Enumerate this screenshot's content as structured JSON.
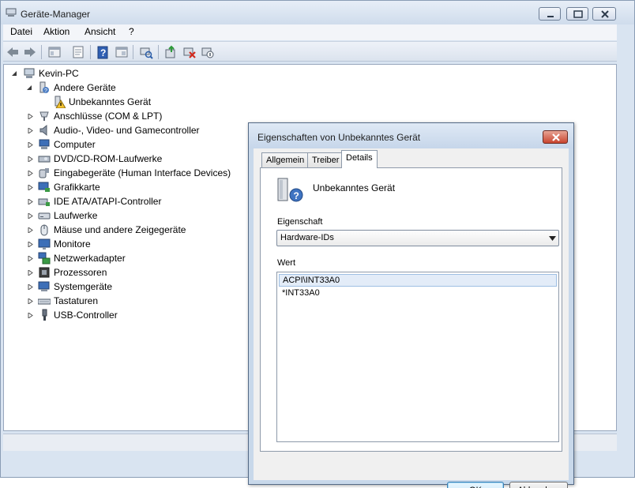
{
  "window": {
    "title": "Geräte-Manager"
  },
  "menu": [
    "Datei",
    "Aktion",
    "Ansicht",
    "?"
  ],
  "toolbar_icons": [
    "back-icon",
    "forward-icon",
    "show-hide-tree-icon",
    "properties-icon",
    "help-icon",
    "view-icon",
    "scan-hardware-icon",
    "update-driver-icon",
    "uninstall-device-icon",
    "disable-device-icon"
  ],
  "tree": {
    "root": "Kevin-PC",
    "other_devices": "Andere Geräte",
    "unknown_device": "Unbekanntes Gerät",
    "categories": [
      "Anschlüsse (COM & LPT)",
      "Audio-, Video- und Gamecontroller",
      "Computer",
      "DVD/CD-ROM-Laufwerke",
      "Eingabegeräte (Human Interface Devices)",
      "Grafikkarte",
      "IDE ATA/ATAPI-Controller",
      "Laufwerke",
      "Mäuse und andere Zeigegeräte",
      "Monitore",
      "Netzwerkadapter",
      "Prozessoren",
      "Systemgeräte",
      "Tastaturen",
      "USB-Controller"
    ]
  },
  "dialog": {
    "title": "Eigenschaften von Unbekanntes Gerät",
    "tabs": [
      "Allgemein",
      "Treiber",
      "Details"
    ],
    "active_tab": "Details",
    "device_name": "Unbekanntes Gerät",
    "property_label": "Eigenschaft",
    "property_value": "Hardware-IDs",
    "value_label": "Wert",
    "values": [
      "ACPI\\INT33A0",
      "*INT33A0"
    ],
    "ok": "OK",
    "cancel": "Abbrechen"
  },
  "colors": {
    "title_bar": "#d3dfee",
    "dialog_frame": "#c8d8ea",
    "selection": "#e3ecf8",
    "close_button": "#c9452f"
  }
}
